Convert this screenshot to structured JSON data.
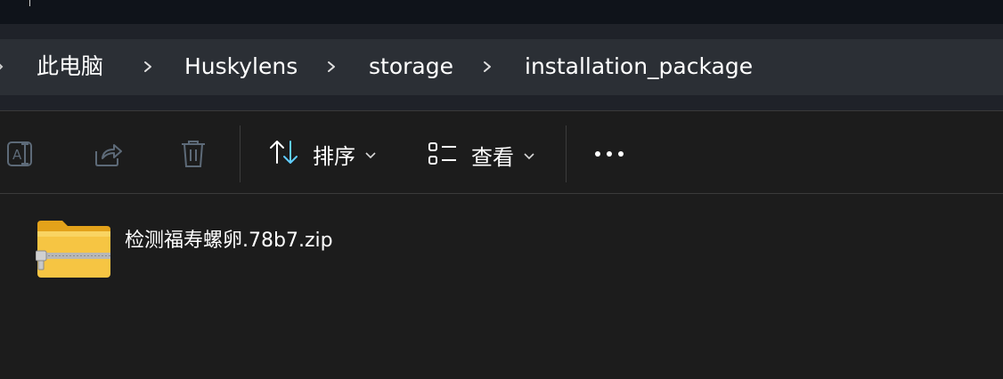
{
  "breadcrumb": {
    "items": [
      "此电脑",
      "Huskylens",
      "storage",
      "installation_package"
    ]
  },
  "toolbar": {
    "sort_label": "排序",
    "view_label": "查看"
  },
  "icons": {
    "rename": "rename-icon",
    "share": "share-icon",
    "delete": "delete-icon",
    "sort": "sort-arrows-icon",
    "view": "view-list-icon",
    "more": "more-icon",
    "zip_folder": "zip-folder-icon"
  },
  "files": [
    {
      "name": "检测福寿螺卵.78b7.zip"
    }
  ],
  "colors": {
    "background": "#1c1c1c",
    "address_bar": "#2b2f35",
    "accent_blue": "#60cdff",
    "folder_yellow": "#f6c543"
  }
}
